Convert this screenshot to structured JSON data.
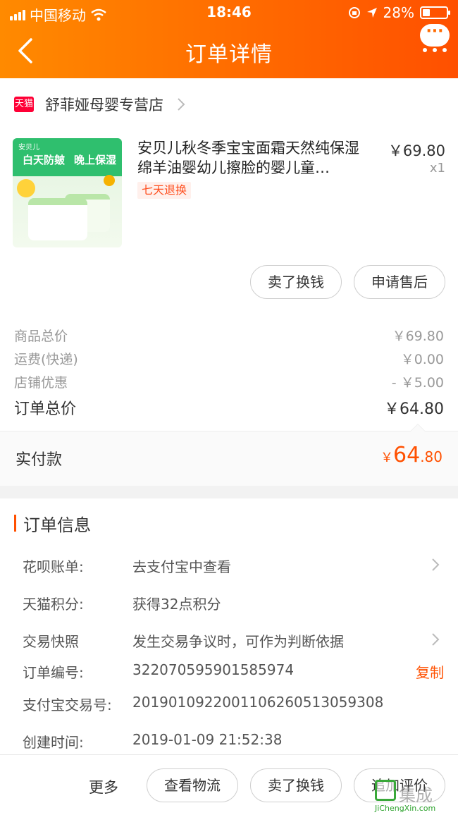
{
  "status_bar": {
    "carrier": "中国移动",
    "time": "18:46",
    "battery": "28%"
  },
  "header": {
    "title": "订单详情"
  },
  "store": {
    "badge": "天猫",
    "name": "舒菲娅母婴专营店"
  },
  "product": {
    "title": "安贝儿秋冬季宝宝面霜天然纯保湿绵羊油婴幼儿擦脸的婴儿童…",
    "tag": "七天退换",
    "price": "￥69.80",
    "qty": "x1",
    "image_texts": {
      "brand": "安贝儿",
      "day": "白天防皴",
      "night": "晚上保湿"
    }
  },
  "product_actions": [
    {
      "label": "卖了换钱"
    },
    {
      "label": "申请售后"
    }
  ],
  "summary": {
    "rows": [
      {
        "label": "商品总价",
        "value": "￥69.80"
      },
      {
        "label": "运费(快递)",
        "value": "￥0.00"
      },
      {
        "label": "店铺优惠",
        "value": "- ￥5.00"
      }
    ],
    "total_label": "订单总价",
    "total_value": "￥64.80",
    "paid_label": "实付款",
    "paid": {
      "currency": "￥",
      "integer": "64",
      "decimal": ".80"
    }
  },
  "order_info": {
    "title": "订单信息",
    "rows": [
      {
        "label": "花呗账单:",
        "value": "去支付宝中查看"
      },
      {
        "label": "天猫积分:",
        "value": "获得32点积分"
      },
      {
        "label": "交易快照",
        "value": "发生交易争议时，可作为判断依据"
      },
      {
        "label": "订单编号:",
        "value": "322070595901585974",
        "action": "复制"
      },
      {
        "label": "支付宝交易号:",
        "value": "2019010922001106260513059308"
      },
      {
        "label": "创建时间:",
        "value": "2019-01-09 21:52:38"
      }
    ]
  },
  "bottom_bar": {
    "more": "更多",
    "buttons": [
      {
        "label": "查看物流"
      },
      {
        "label": "卖了换钱"
      },
      {
        "label": "追加评价"
      }
    ]
  },
  "watermark": {
    "text": "集成",
    "url": "JiChengXin.com"
  },
  "colors": {
    "header_start": "#ff8a00",
    "header_end": "#ff5000",
    "accent": "#ff5000",
    "tmall": "#ff0036"
  }
}
